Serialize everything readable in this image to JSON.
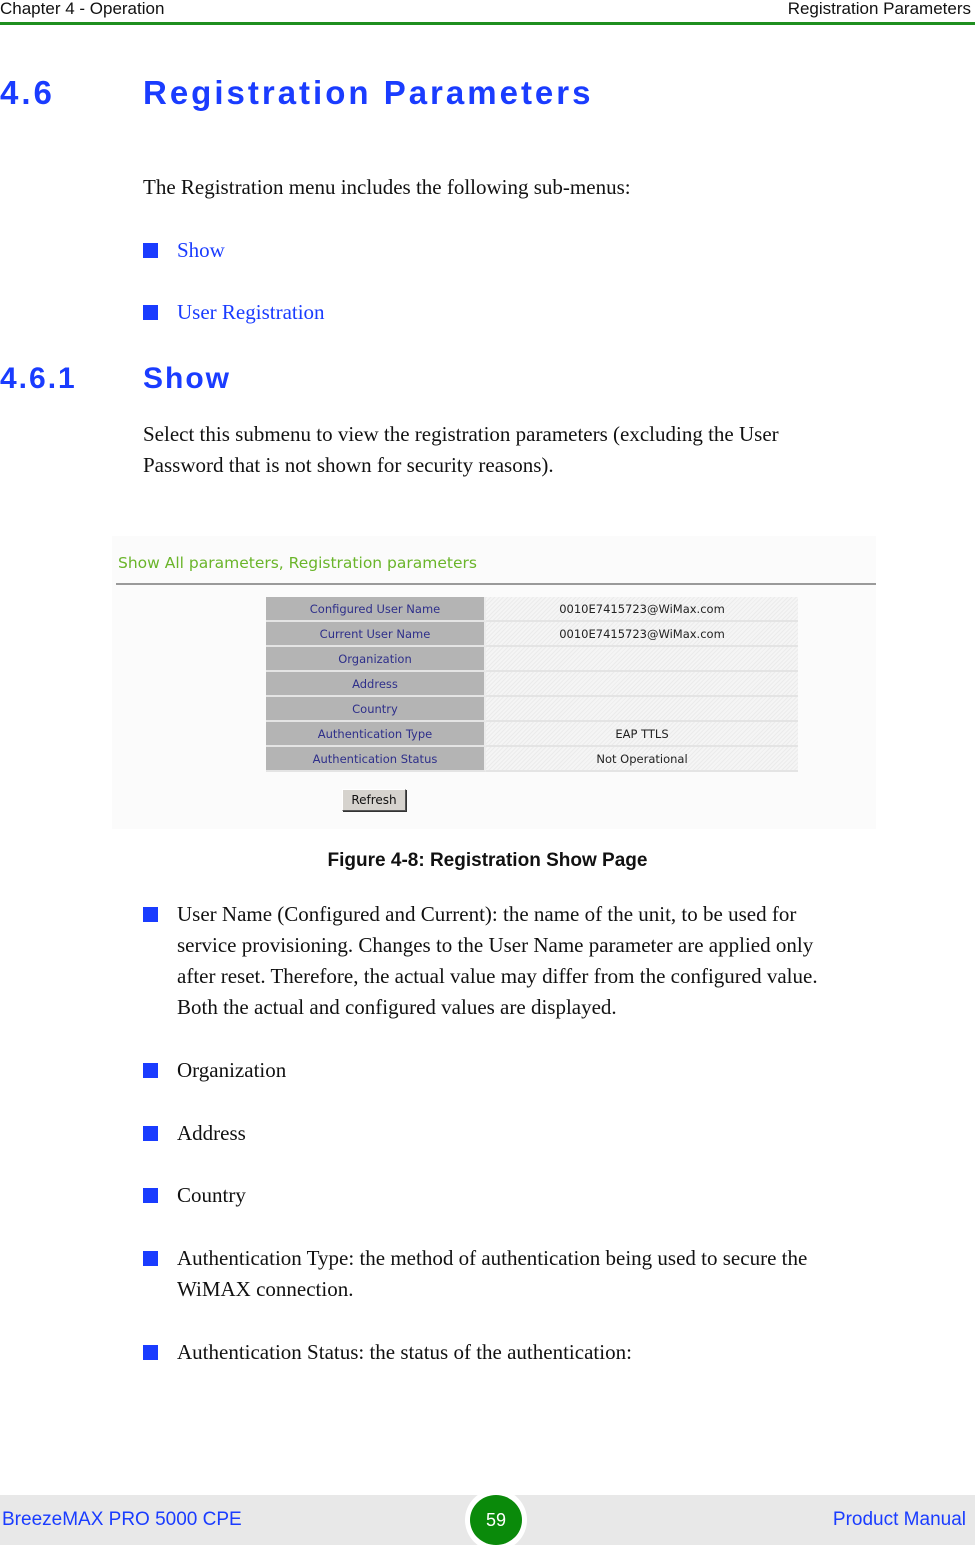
{
  "header": {
    "left": "Chapter 4 - Operation",
    "right": "Registration Parameters"
  },
  "section": {
    "number": "4.6",
    "title": "Registration Parameters",
    "intro": "The Registration menu includes the following sub-menus:",
    "submenus": [
      "Show",
      "User Registration"
    ]
  },
  "subsection": {
    "number": "4.6.1",
    "title": "Show",
    "body_line1": "Select this submenu to view the registration parameters (excluding the User",
    "body_line2": "Password that is not shown for security reasons)."
  },
  "figure": {
    "panel_title": "Show All parameters, Registration parameters",
    "rows": [
      {
        "label": "Configured User Name",
        "value": "0010E7415723@WiMax.com"
      },
      {
        "label": "Current User Name",
        "value": "0010E7415723@WiMax.com"
      },
      {
        "label": "Organization",
        "value": ""
      },
      {
        "label": "Address",
        "value": ""
      },
      {
        "label": "Country",
        "value": ""
      },
      {
        "label": "Authentication Type",
        "value": "EAP TTLS"
      },
      {
        "label": "Authentication Status",
        "value": "Not Operational"
      }
    ],
    "refresh_label": "Refresh",
    "caption": "Figure 4-8: Registration Show Page"
  },
  "bullets": [
    {
      "lines": [
        "User Name (Configured and Current): the name of the unit, to be used for",
        "service provisioning. Changes to the User Name parameter are applied only",
        "after reset. Therefore, the actual value may differ from the configured value.",
        "Both the actual and configured values are displayed."
      ]
    },
    {
      "lines": [
        "Organization"
      ]
    },
    {
      "lines": [
        "Address"
      ]
    },
    {
      "lines": [
        "Country"
      ]
    },
    {
      "lines": [
        "Authentication Type: the method of authentication being used to secure the",
        "WiMAX connection."
      ]
    },
    {
      "lines": [
        "Authentication Status: the status of the authentication:"
      ]
    }
  ],
  "footer": {
    "left": "BreezeMAX PRO 5000 CPE",
    "page": "59",
    "right": "Product Manual"
  },
  "colors": {
    "heading_blue": "#1a3cff",
    "rule_green": "#1f8f1f",
    "panel_title_green": "#6ab52a",
    "page_badge_green": "#0a8a0a"
  }
}
